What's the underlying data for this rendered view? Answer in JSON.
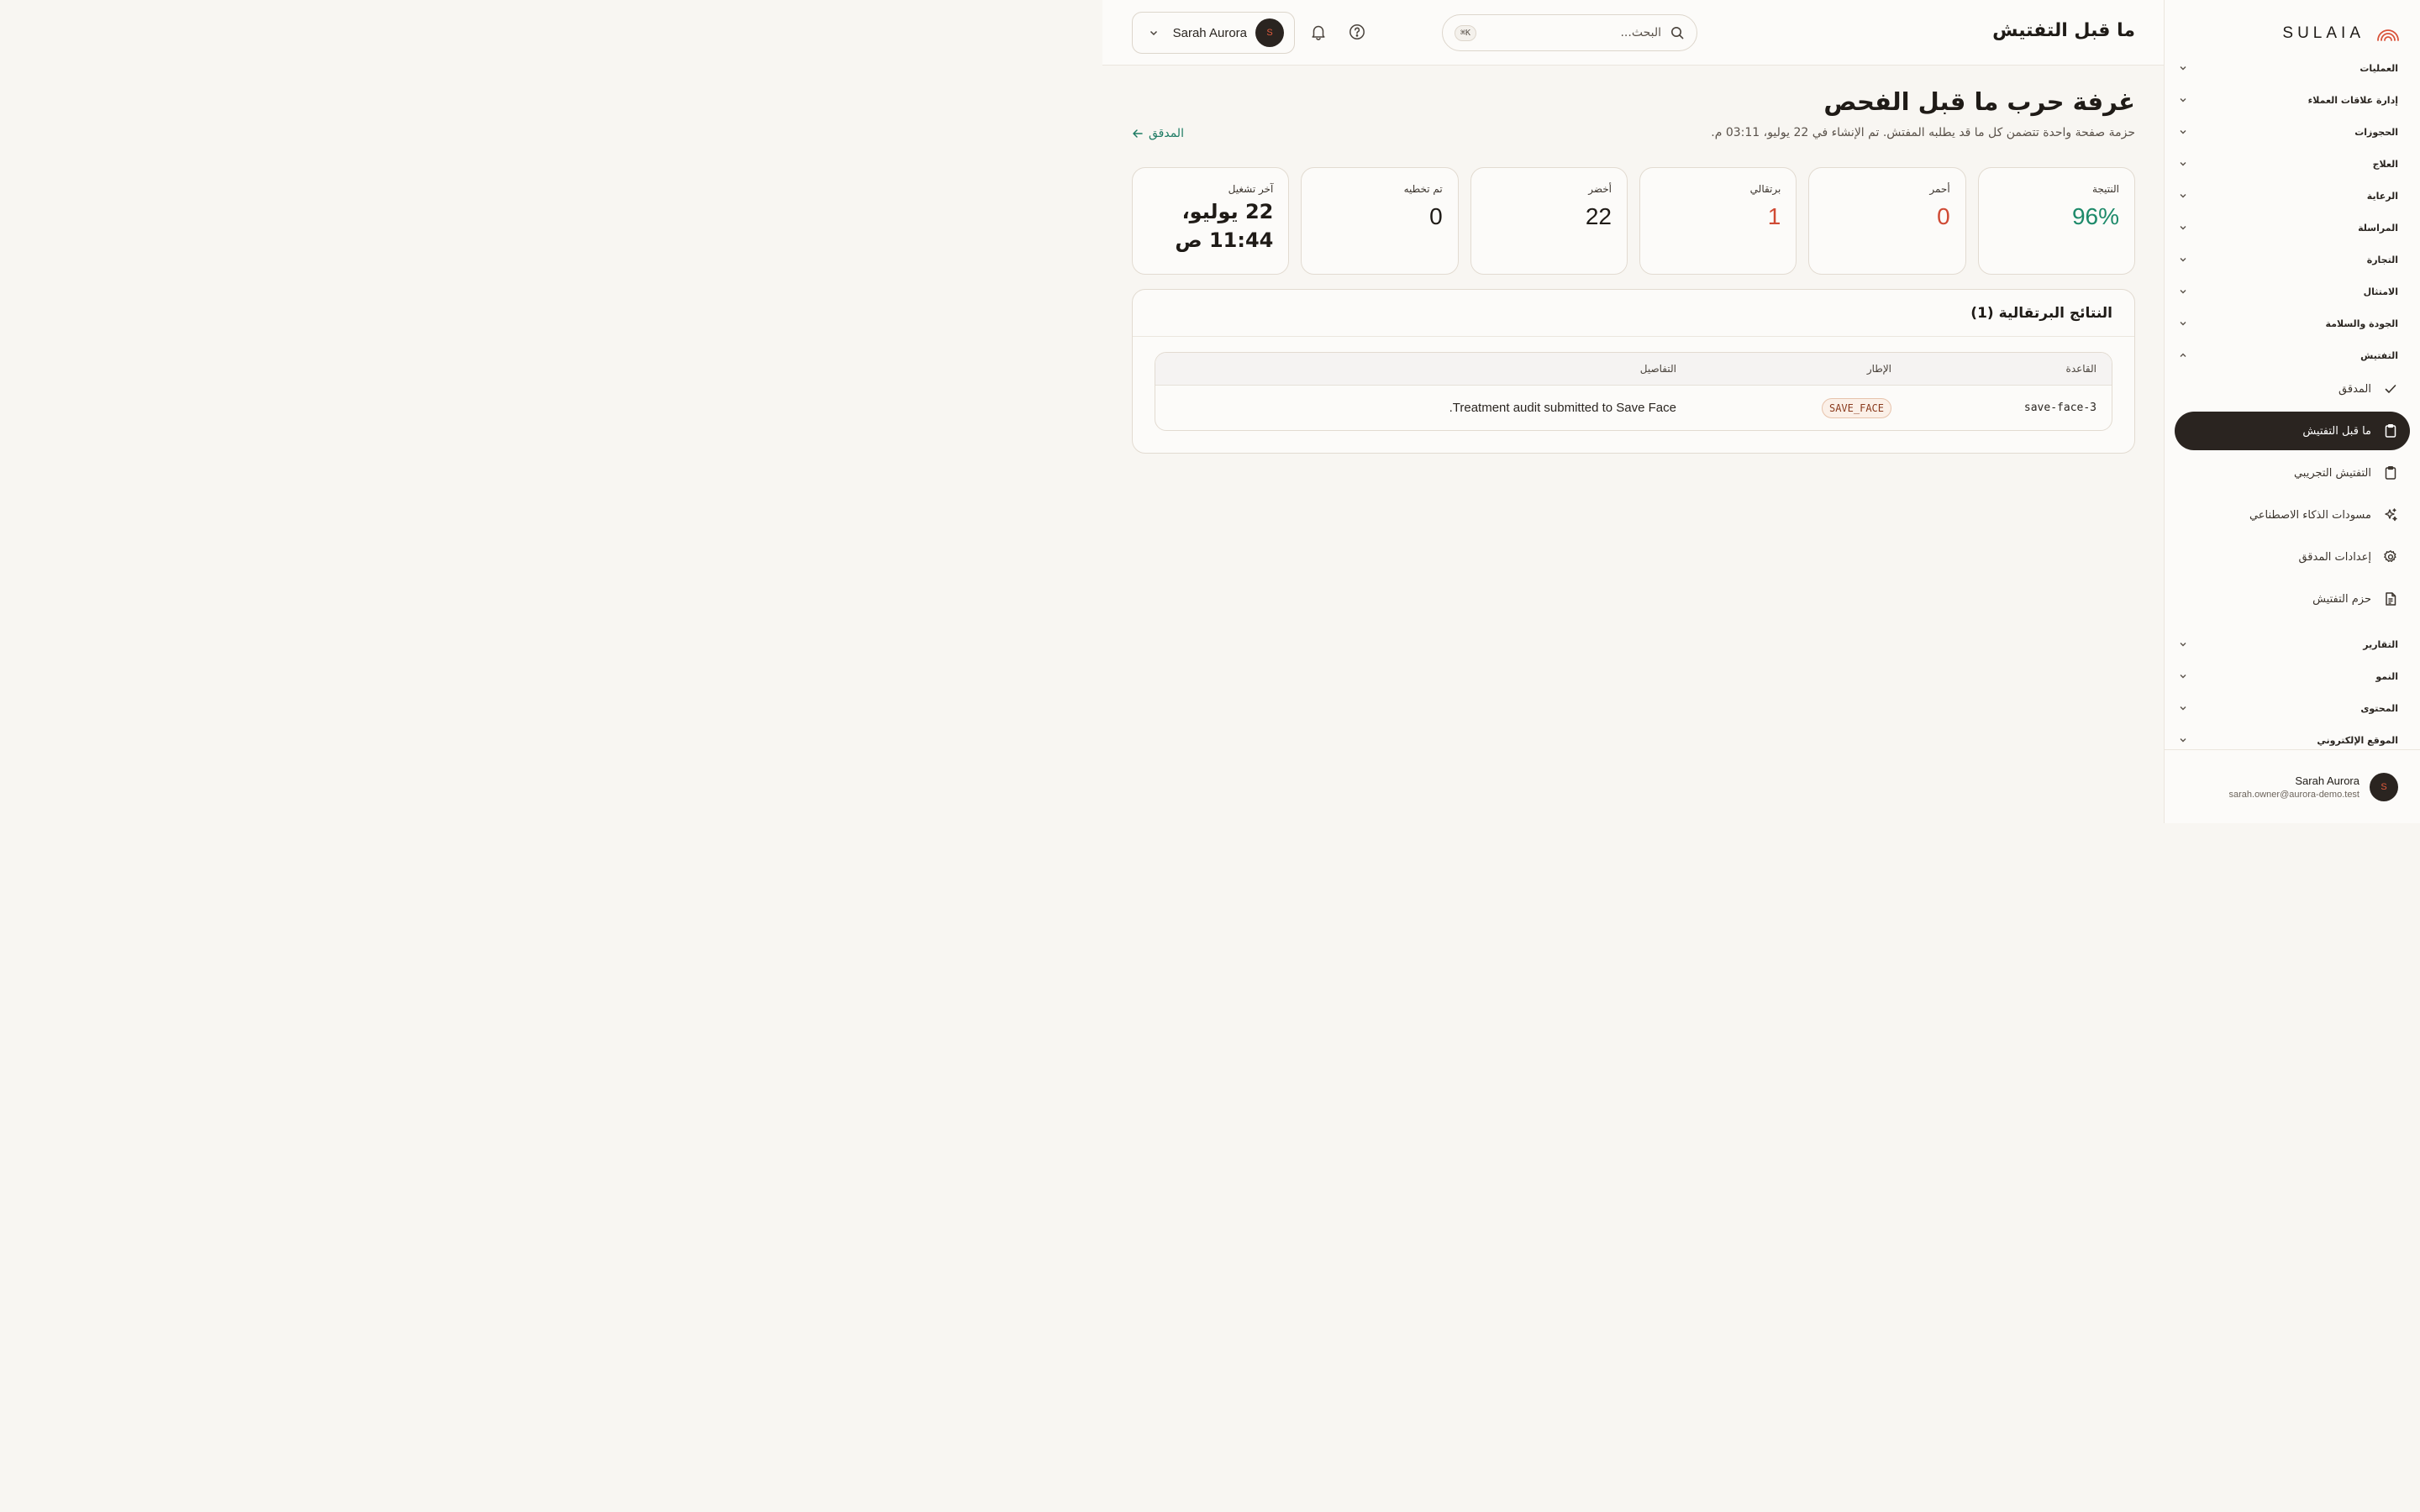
{
  "brand": {
    "name": "SULAIA"
  },
  "header": {
    "title": "ما قبل التفتيش",
    "search_placeholder": "البحث...",
    "search_shortcut": "⌘K",
    "user_name": "Sarah Aurora",
    "avatar_initial": "S"
  },
  "sidebar": {
    "groups_top": [
      {
        "label": "العمليات"
      },
      {
        "label": "إدارة علاقات العملاء"
      },
      {
        "label": "الحجوزات"
      },
      {
        "label": "العلاج"
      },
      {
        "label": "الرعاية"
      },
      {
        "label": "المراسلة"
      },
      {
        "label": "التجارة"
      },
      {
        "label": "الامتثال"
      },
      {
        "label": "الجودة والسلامة"
      },
      {
        "label": "التفتيش"
      }
    ],
    "inspection_items": [
      {
        "label": "المدقق",
        "icon": "check-icon"
      },
      {
        "label": "ما قبل التفتيش",
        "icon": "clipboard-icon",
        "active": true
      },
      {
        "label": "التفتيش التجريبي",
        "icon": "clipboard-icon"
      },
      {
        "label": "مسودات الذكاء الاصطناعي",
        "icon": "sparkles-icon"
      },
      {
        "label": "إعدادات المدقق",
        "icon": "gear-icon"
      },
      {
        "label": "حزم التفتيش",
        "icon": "document-icon"
      }
    ],
    "groups_bottom": [
      {
        "label": "التقارير"
      },
      {
        "label": "النمو"
      },
      {
        "label": "المحتوى"
      },
      {
        "label": "الموقع الإلكتروني"
      }
    ],
    "user": {
      "name": "Sarah Aurora",
      "email": "sarah.owner@aurora-demo.test",
      "initial": "S"
    }
  },
  "main": {
    "heading": "غرفة حرب ما قبل الفحص",
    "subtitle": "حزمة صفحة واحدة تتضمن كل ما قد يطلبه المفتش. تم الإنشاء في 22 يوليو، 03:11 م.",
    "back_link": "المدقق",
    "stats": [
      {
        "label": "النتيجة",
        "value": "96%",
        "color": "#1d8a6a"
      },
      {
        "label": "أحمر",
        "value": "0",
        "color": "#cf4a34"
      },
      {
        "label": "برتقالي",
        "value": "1",
        "color": "#cf4a34"
      },
      {
        "label": "أخضر",
        "value": "22",
        "color": "#1f1b17"
      },
      {
        "label": "تم تخطيه",
        "value": "0",
        "color": "#1f1b17"
      },
      {
        "label": "آخر تشغيل",
        "value": "22 يوليو، 11:44 ص",
        "color": "#1f1b17"
      }
    ],
    "orange_results": {
      "title": "النتائج البرتقالية (1)",
      "columns": {
        "rule": "القاعدة",
        "frame": "الإطار",
        "details": "التفاصيل"
      },
      "rows": [
        {
          "rule": "save-face-3",
          "frame": "SAVE_FACE",
          "details": "Treatment audit submitted to Save Face."
        }
      ]
    }
  }
}
